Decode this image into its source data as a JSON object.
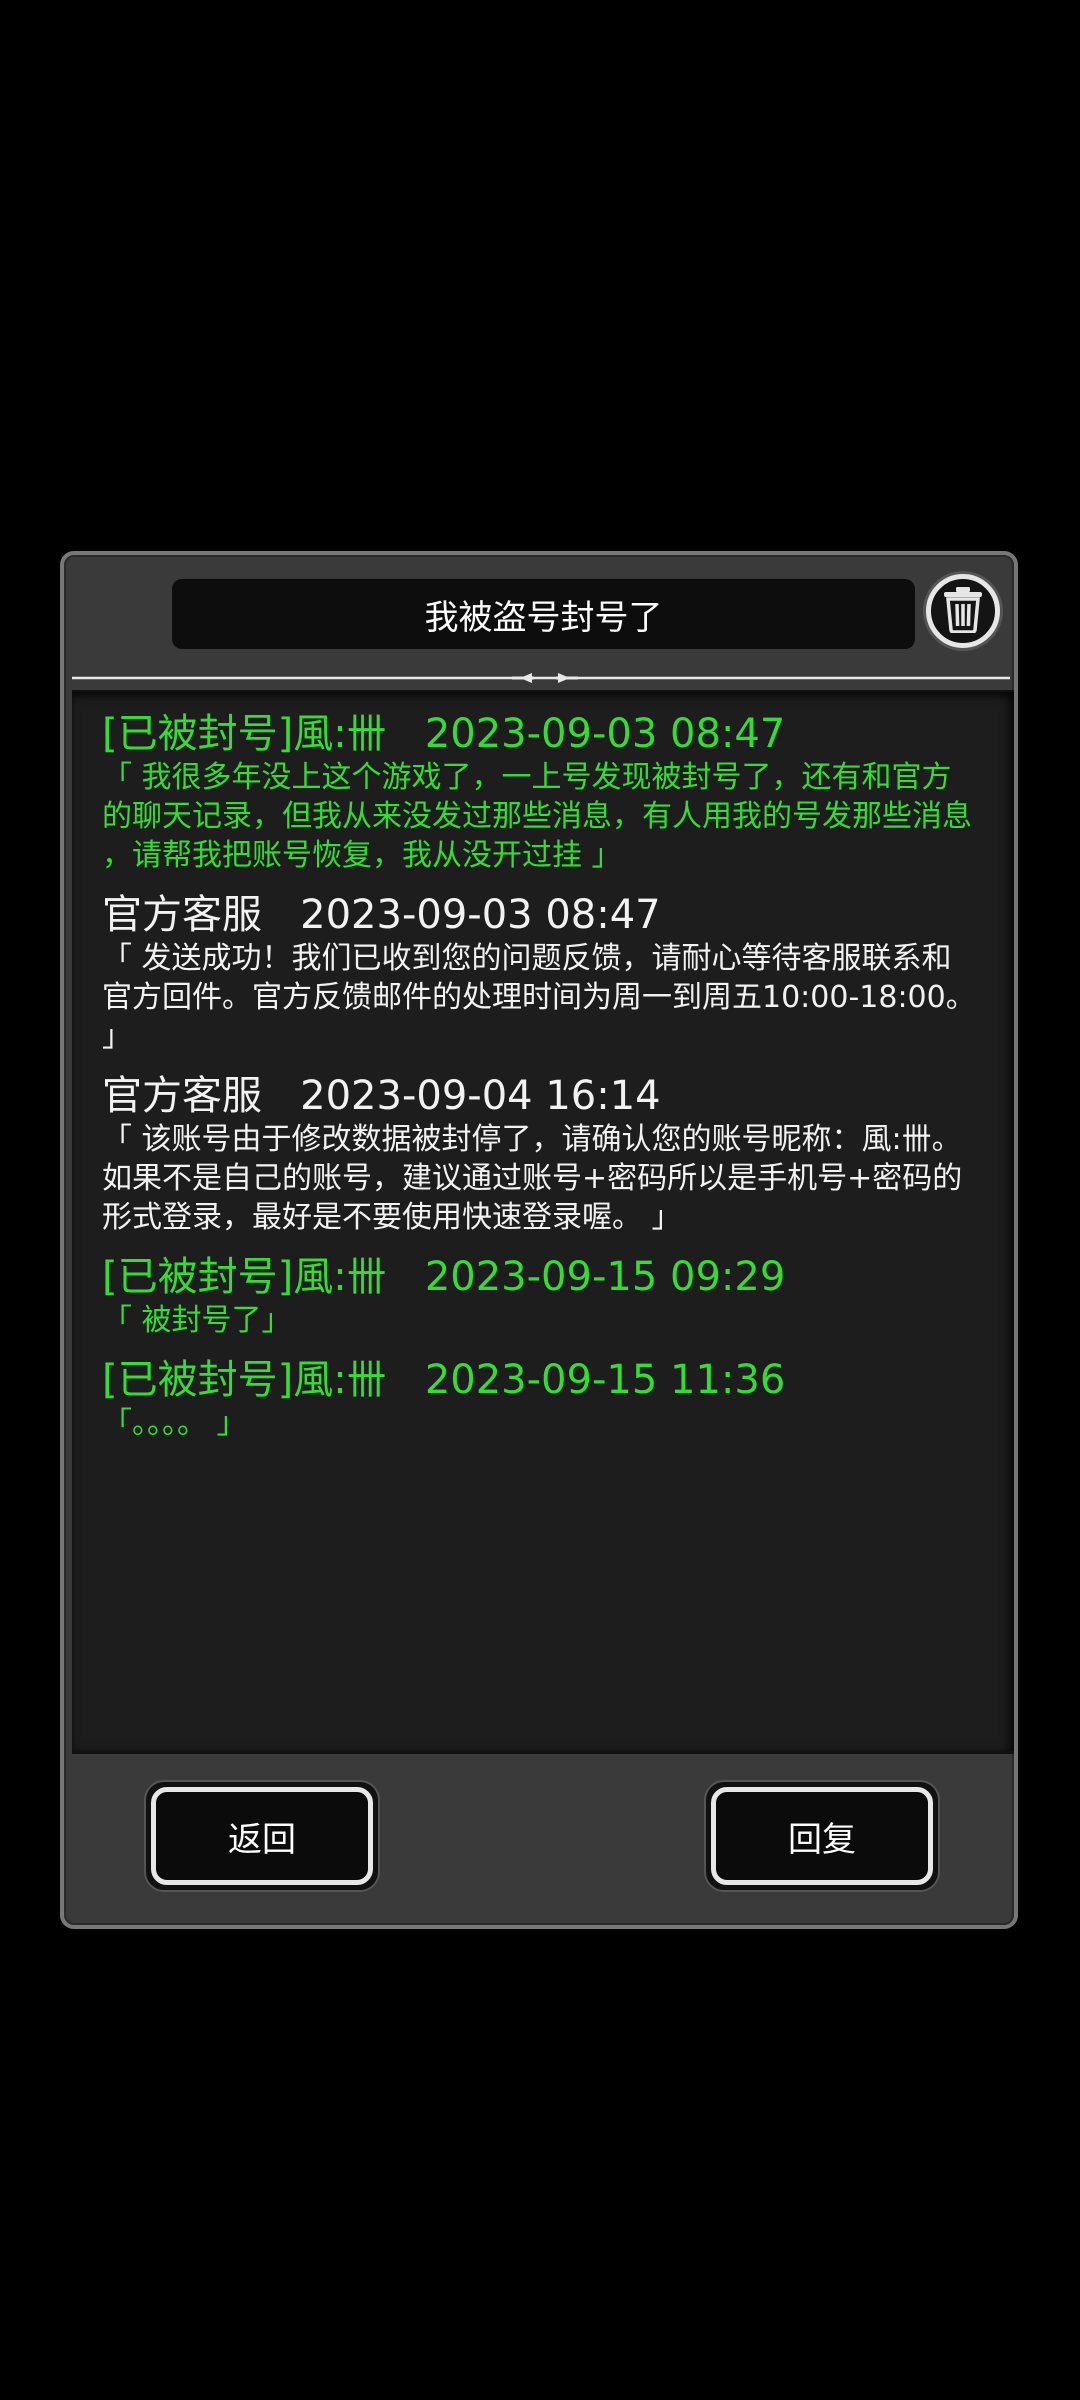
{
  "dialog": {
    "title": "我被盗号封号了",
    "trash_icon": "trash-icon"
  },
  "messages": [
    {
      "kind": "player",
      "header": "[已被封号]風:卌   2023-09-03 08:47",
      "body": "「 我很多年没上这个游戏了，一上号发现被封号了，还有和官方\n的聊天记录，但我从来没发过那些消息，有人用我的号发那些消息\n，请帮我把账号恢复，我从没开过挂 」"
    },
    {
      "kind": "official",
      "header": "官方客服   2023-09-03 08:47",
      "body": "「 发送成功！我们已收到您的问题反馈，请耐心等待客服联系和\n官方回件。官方反馈邮件的处理时间为周一到周五10:00-18:00。\n」"
    },
    {
      "kind": "official",
      "header": "官方客服   2023-09-04 16:14",
      "body": "「 该账号由于修改数据被封停了，请确认您的账号昵称：風:卌。\n如果不是自己的账号，建议通过账号+密码所以是手机号+密码的\n形式登录，最好是不要使用快速登录喔。 」"
    },
    {
      "kind": "player",
      "header": "[已被封号]風:卌   2023-09-15 09:29",
      "body": "「 被封号了」"
    },
    {
      "kind": "player",
      "header": "[已被封号]風:卌   2023-09-15 11:36",
      "body": "「。。。。 」"
    }
  ],
  "buttons": {
    "back_label": "返回",
    "reply_label": "回复"
  },
  "colors": {
    "player_text": "#33dd33",
    "official_text": "#f2f2f2",
    "panel_bg": "#3a3a3a",
    "content_bg": "#1d1d1d"
  }
}
